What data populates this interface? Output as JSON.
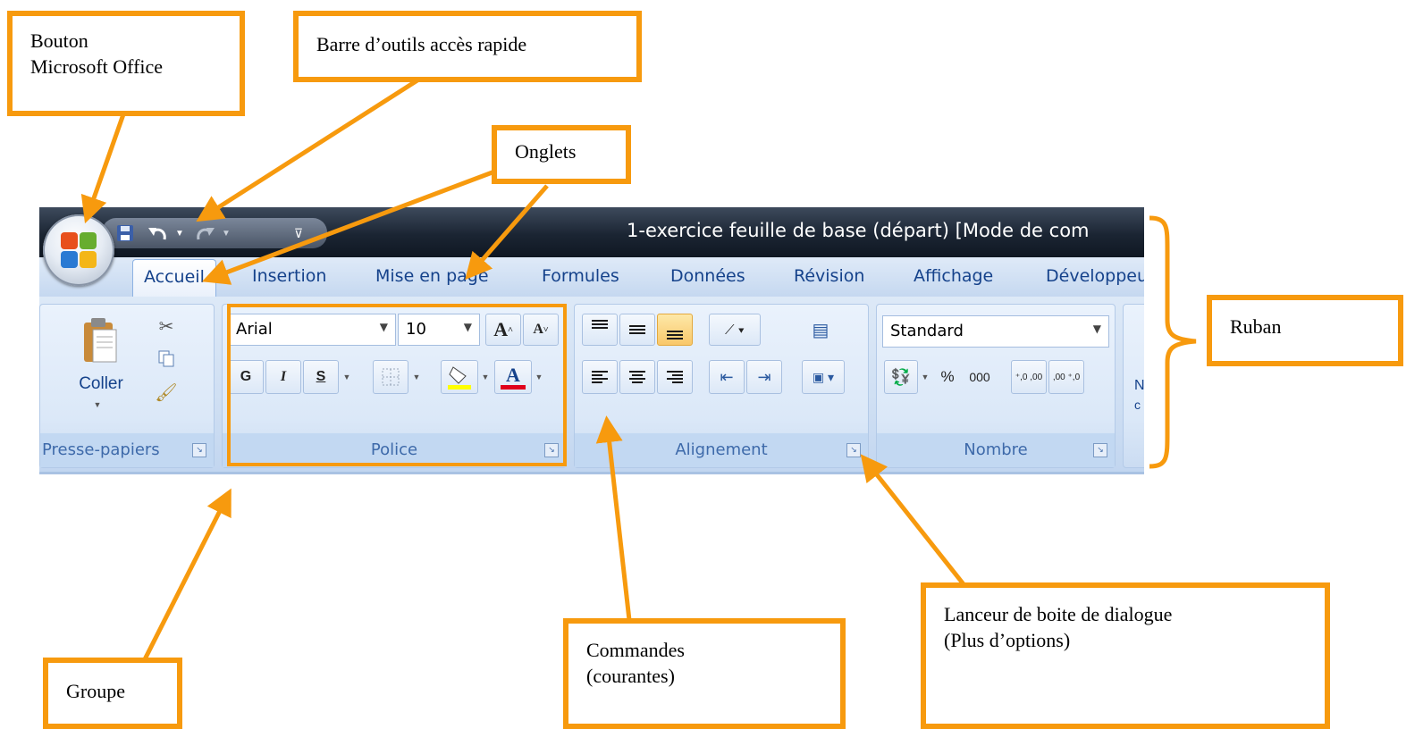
{
  "window": {
    "title": "1-exercice feuille de base (départ)  [Mode de com"
  },
  "tabs": [
    "Accueil",
    "Insertion",
    "Mise en page",
    "Formules",
    "Données",
    "Révision",
    "Affichage",
    "Développeu"
  ],
  "clipboard": {
    "paste_label": "Coller",
    "group_label": "Presse-papiers"
  },
  "font": {
    "name": "Arial",
    "size": "10",
    "grow": "A",
    "shrink": "A",
    "bold": "G",
    "italic": "I",
    "underline": "S",
    "color_letter": "A",
    "group_label": "Police",
    "highlight_color": "#ffff00",
    "font_color": "#ff0000"
  },
  "alignment": {
    "group_label": "Alignement"
  },
  "number": {
    "format": "Standard",
    "percent": "%",
    "thousands": "000",
    "inc_decimal": "⁺,0 ,00",
    "dec_decimal": ",00 ⁺,0",
    "group_label": "Nombre"
  },
  "cut_label_partial": {
    "top": "N",
    "bottom": "c"
  },
  "launcher_glyph": "↘",
  "annotations": {
    "office_button": [
      "Bouton",
      "Microsoft Office"
    ],
    "quick_access": [
      "Barre d’outils accès rapide"
    ],
    "tabs": [
      "Onglets"
    ],
    "ribbon": [
      "Ruban"
    ],
    "group": [
      "Groupe"
    ],
    "commands": [
      "Commandes",
      "(courantes)"
    ],
    "launcher": [
      "Lanceur de boite de dialogue",
      "(Plus d’options)"
    ]
  },
  "colors": {
    "accent": "#f79a0e",
    "ribbon_text": "#15428b",
    "title_bg": "#1b2533"
  }
}
